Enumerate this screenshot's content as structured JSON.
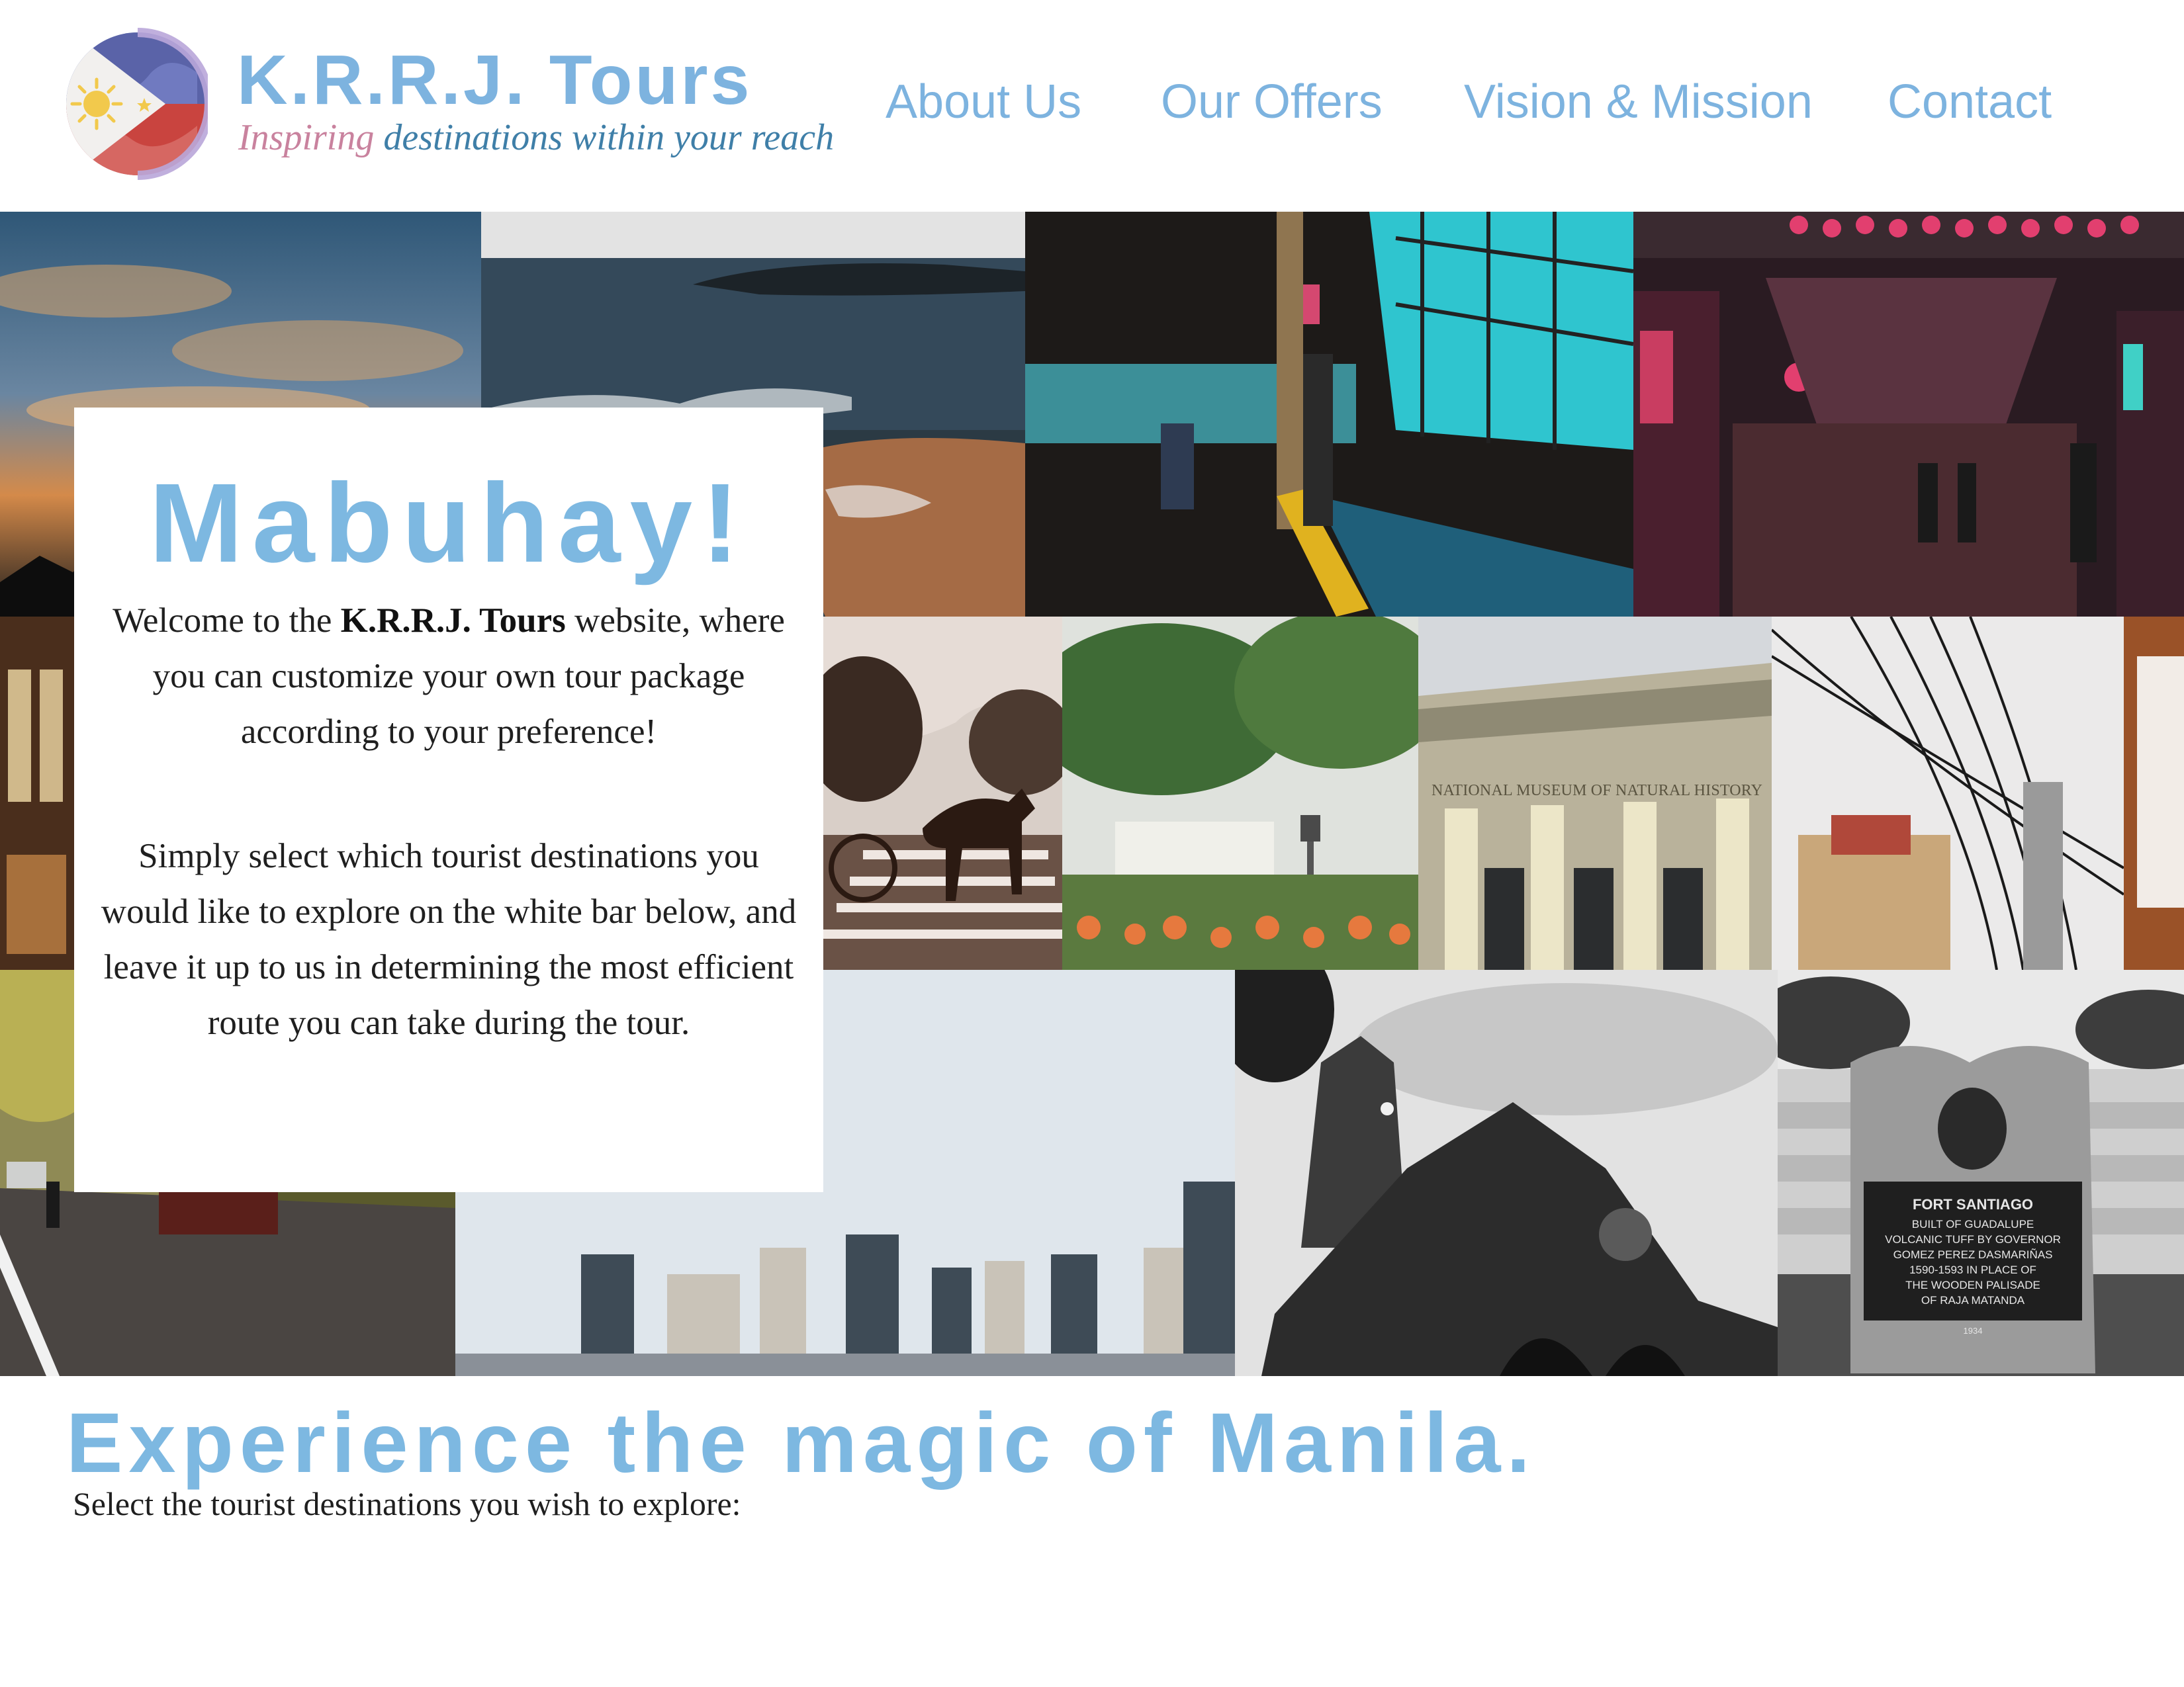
{
  "header": {
    "brand_name": "K.R.R.J. Tours",
    "tagline_part1": "Inspiring",
    "tagline_part2": " destinations within your reach",
    "nav": [
      {
        "label": "About Us"
      },
      {
        "label": "Our Offers"
      },
      {
        "label": "Vision & Mission"
      },
      {
        "label": "Contact"
      }
    ]
  },
  "welcome": {
    "title": "Mabuhay!",
    "p1_before": "Welcome to the ",
    "p1_brand": "K.R.R.J. Tours",
    "p1_after": " website, where you can customize your own tour package  according to your preference!",
    "p2": "Simply select which tourist destinations you would like to explore on the white bar below, and leave it up to us in determining the most efficient route you can take during the tour."
  },
  "gallery": {
    "museum_sign": "NATIONAL MUSEUM OF NATURAL HISTORY",
    "marker_title": "FORT SANTIAGO",
    "marker_lines": [
      "BUILT OF GUADALUPE",
      "VOLCANIC TUFF BY GOVERNOR",
      "GOMEZ PEREZ DASMARIÑAS",
      "1590-1593 IN PLACE OF",
      "THE WOODEN PALISADE",
      "OF RAJA MATANDA"
    ],
    "marker_year": "1934"
  },
  "bottom": {
    "headline": "Experience the magic of Manila.",
    "instruction": "Select the tourist destinations you wish to explore:"
  },
  "colors": {
    "accent": "#7db8e1",
    "tagline_pink": "#c9829e",
    "tagline_blue": "#3f7fa8"
  },
  "icons": {
    "logo": "philippine-flag-circle-logo"
  }
}
